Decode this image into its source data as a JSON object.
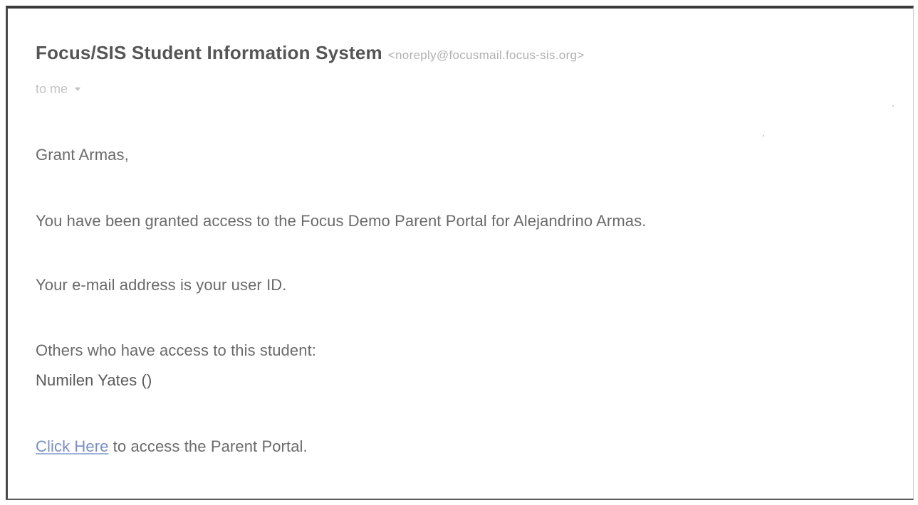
{
  "email": {
    "sender_name": "Focus/SIS Student Information System",
    "sender_email": "<noreply@focusmail.focus-sis.org>",
    "recipient": "to me",
    "greeting": "Grant Armas,",
    "access_line": "You have been granted access to the Focus Demo Parent Portal for Alejandrino Armas.",
    "userid_line": "Your e-mail address is your user ID.",
    "others_heading": "Others who have access to this student:",
    "others_names": "Numilen Yates ()",
    "link_text": "Click Here",
    "link_suffix": " to access the Parent Portal."
  }
}
